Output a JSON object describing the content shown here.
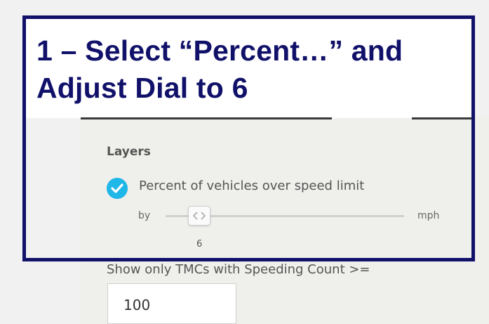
{
  "callout": {
    "line1": "1 – Select “Percent…” and",
    "line2": "Adjust Dial to 6",
    "color": "#11116a"
  },
  "layers": {
    "title": "Layers",
    "items": [
      {
        "label": "Percent of vehicles over speed limit",
        "checked": true,
        "icon": "check-icon"
      }
    ]
  },
  "slider": {
    "prefix": "by",
    "suffix": "mph",
    "value": "6",
    "handle_icon": "chevron-left-right-icon"
  },
  "filter": {
    "label": "Show only TMCs with Speeding Count >=",
    "value": "100"
  },
  "colors": {
    "accent": "#1fb6e8",
    "panel_bg": "#efefec"
  }
}
